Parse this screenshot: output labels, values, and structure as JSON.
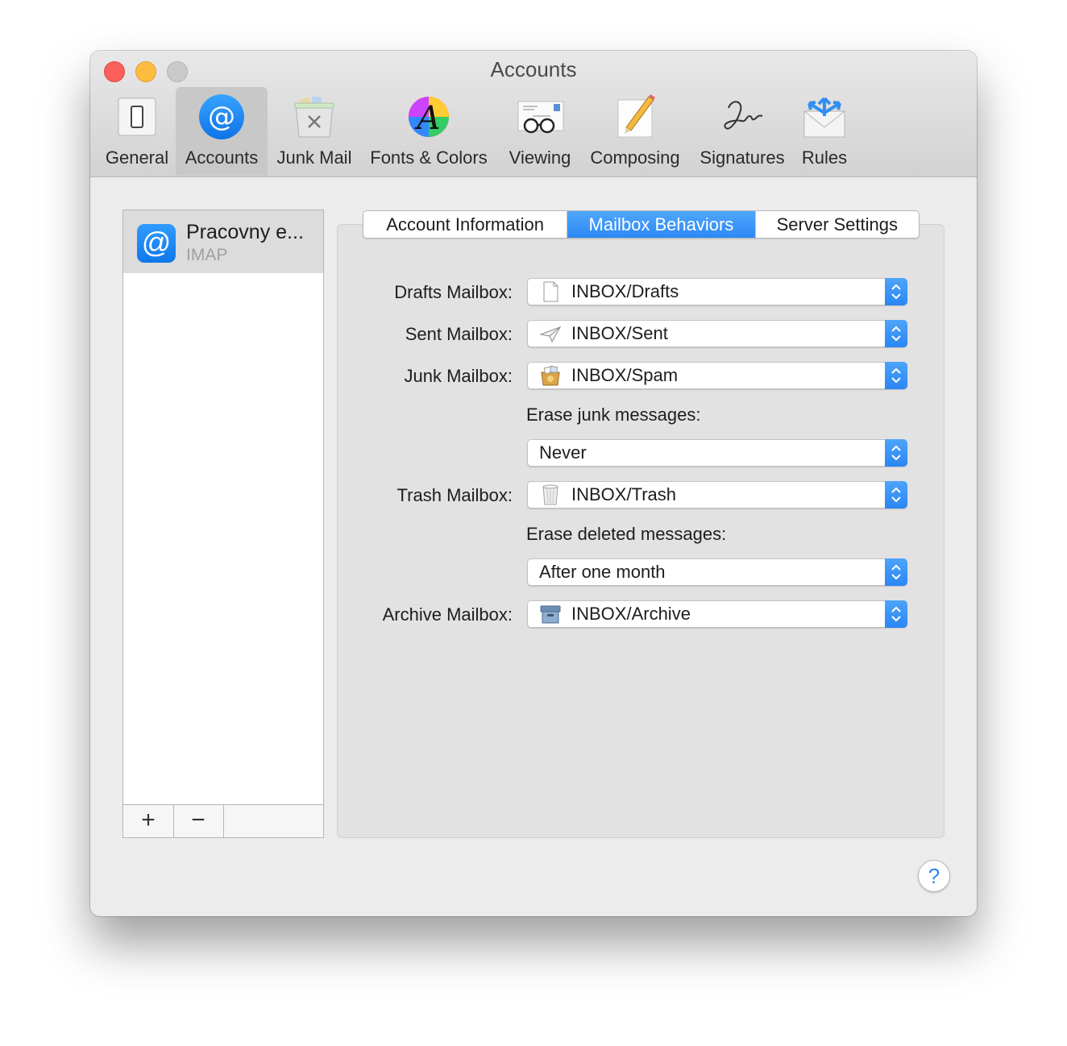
{
  "window": {
    "title": "Accounts"
  },
  "toolbar": {
    "items": [
      {
        "label": "General",
        "icon": "general-switch-icon"
      },
      {
        "label": "Accounts",
        "icon": "at-sign-icon",
        "selected": true
      },
      {
        "label": "Junk Mail",
        "icon": "junk-bin-icon"
      },
      {
        "label": "Fonts & Colors",
        "icon": "font-color-wheel-icon"
      },
      {
        "label": "Viewing",
        "icon": "glasses-letter-icon"
      },
      {
        "label": "Composing",
        "icon": "pencil-paper-icon"
      },
      {
        "label": "Signatures",
        "icon": "signature-icon"
      },
      {
        "label": "Rules",
        "icon": "rules-envelope-icon"
      }
    ]
  },
  "accounts": [
    {
      "name": "Pracovny e...",
      "type": "IMAP",
      "selected": true
    }
  ],
  "list_controls": {
    "add": "+",
    "remove": "−"
  },
  "tabs": [
    {
      "label": "Account Information"
    },
    {
      "label": "Mailbox Behaviors",
      "active": true
    },
    {
      "label": "Server Settings"
    }
  ],
  "form": {
    "drafts": {
      "label": "Drafts Mailbox:",
      "value": "INBOX/Drafts",
      "icon": "document-icon"
    },
    "sent": {
      "label": "Sent Mailbox:",
      "value": "INBOX/Sent",
      "icon": "paper-plane-icon"
    },
    "junk": {
      "label": "Junk Mailbox:",
      "value": "INBOX/Spam",
      "icon": "junk-box-icon"
    },
    "erase_junk": {
      "label": "Erase junk messages:",
      "value": "Never"
    },
    "trash": {
      "label": "Trash Mailbox:",
      "value": "INBOX/Trash",
      "icon": "trash-can-icon"
    },
    "erase_deleted": {
      "label": "Erase deleted messages:",
      "value": "After one month"
    },
    "archive": {
      "label": "Archive Mailbox:",
      "value": "INBOX/Archive",
      "icon": "archive-box-icon"
    }
  },
  "help": {
    "label": "?"
  },
  "colors": {
    "accent": "#2d89f4",
    "close": "#fc605b",
    "minimize": "#fdbc40"
  }
}
